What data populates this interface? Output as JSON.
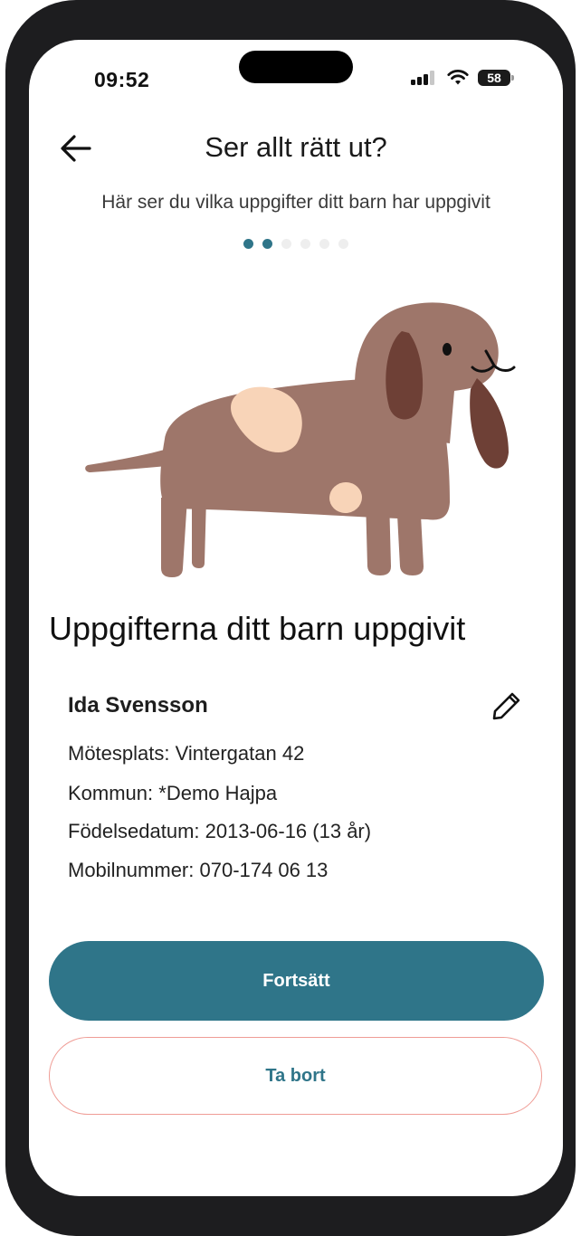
{
  "status_bar": {
    "time": "09:52",
    "battery": "58",
    "icons": [
      "signal-icon",
      "wifi-icon",
      "battery-icon"
    ]
  },
  "header": {
    "title": "Ser allt rätt ut?",
    "back_icon": "arrow-left-icon",
    "subtitle": "Här ser du vilka uppgifter ditt barn har uppgivit"
  },
  "progress": {
    "total_steps": 6,
    "active_steps": 2
  },
  "illustration": {
    "icon": "dog-illustration",
    "colors": {
      "body": "#9e766a",
      "ears": "#6e4036",
      "spots": "#f8d4b8"
    }
  },
  "main": {
    "section_title": "Uppgifterna ditt barn uppgivit",
    "child": {
      "name": "Ida Svensson",
      "edit_icon": "pencil-icon",
      "details": [
        "Mötesplats: Vintergatan 42",
        "Kommun: *Demo Hajpa",
        "Födelsedatum: 2013-06-16 (13 år)",
        "Mobilnummer: 070-174 06 13"
      ]
    }
  },
  "actions": {
    "continue_label": "Fortsätt",
    "remove_label": "Ta bort"
  },
  "colors": {
    "accent": "#2f7589",
    "remove_border": "#ef9c95"
  }
}
